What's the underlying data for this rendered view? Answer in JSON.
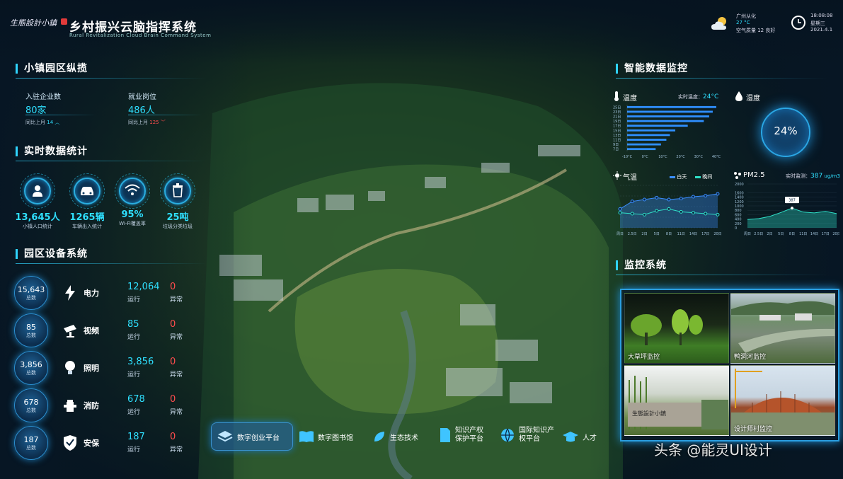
{
  "header": {
    "logo_text": "生態設計小鎮",
    "title": "乡村振兴云脑指挥系统",
    "subtitle": "Rural Revitalization Cloud Brain Command System",
    "weather": {
      "icon": "cloud-sun-icon",
      "city": "广州从化",
      "temp": "27 °C",
      "air": "空气质量 12 良好"
    },
    "time": {
      "icon": "clock-icon",
      "clock": "18:08:08",
      "weekday": "星期三",
      "date": "2021.4.1"
    }
  },
  "overview": {
    "title": "小镇园区纵揽",
    "items": [
      {
        "label": "入驻企业数",
        "value": "80家",
        "compare": "同比上月",
        "change": "14"
      },
      {
        "label": "就业岗位",
        "value": "486人",
        "compare": "同比上月",
        "change": "125"
      }
    ]
  },
  "realtime": {
    "title": "实时数据统计",
    "items": [
      {
        "icon": "person-icon",
        "value": "13,645人",
        "label": "小镇人口统计"
      },
      {
        "icon": "car-icon",
        "value": "1265辆",
        "label": "车辆出入统计"
      },
      {
        "icon": "wifi-icon",
        "value": "95%",
        "label": "Wi-Fi覆盖率"
      },
      {
        "icon": "trash-icon",
        "value": "25吨",
        "label": "垃圾分类垃圾"
      }
    ]
  },
  "devices": {
    "title": "园区设备系统",
    "run_label": "运行",
    "err_label": "异常",
    "total_label": "总数",
    "items": [
      {
        "icon": "lightning-icon",
        "total": "15,643",
        "name": "电力",
        "run": "12,064",
        "err": "0"
      },
      {
        "icon": "camera-icon",
        "total": "85",
        "name": "视频",
        "run": "85",
        "err": "0"
      },
      {
        "icon": "bulb-icon",
        "total": "3,856",
        "name": "照明",
        "run": "3,856",
        "err": "0"
      },
      {
        "icon": "hydrant-icon",
        "total": "678",
        "name": "消防",
        "run": "678",
        "err": "0"
      },
      {
        "icon": "shield-icon",
        "total": "187",
        "name": "安保",
        "run": "187",
        "err": "0"
      }
    ]
  },
  "bottom_nav": [
    {
      "icon": "layers-icon",
      "label": "数字创业平台"
    },
    {
      "icon": "book-icon",
      "label": "数字图书馆"
    },
    {
      "icon": "leaf-icon",
      "label": "生态技术"
    },
    {
      "icon": "document-icon",
      "label": "知识产权保护平台"
    },
    {
      "icon": "globe-icon",
      "label": "国际知识产权平台"
    },
    {
      "icon": "graduation-cap-icon",
      "label": "人才"
    }
  ],
  "monitor": {
    "title": "智能数据监控",
    "temperature": {
      "label": "温度",
      "realtime_label": "实时温度：",
      "realtime_value": "24°C"
    },
    "humidity": {
      "label": "湿度",
      "value": "24%"
    },
    "weather_chart": {
      "label": "气温",
      "legend": [
        "白天",
        "晚间"
      ]
    },
    "pm25": {
      "label": "PM2.5",
      "realtime_label": "实时监测：",
      "realtime_value": "387",
      "unit": "ug/m3",
      "marker": "387"
    }
  },
  "surveillance": {
    "title": "监控系统",
    "cameras": [
      {
        "label": "大草坪监控"
      },
      {
        "label": "鸭洞河监控"
      },
      {
        "label": ""
      },
      {
        "label": "设计师村监控"
      }
    ]
  },
  "watermark": "头条 @能灵UI设计",
  "chart_data": [
    {
      "type": "bar",
      "orientation": "horizontal",
      "title": "温度",
      "categories": [
        "25日",
        "23日",
        "21日",
        "19日",
        "17日",
        "15日",
        "13日",
        "11日",
        "9日",
        "7日"
      ],
      "series": [
        {
          "values": [
            40,
            38,
            36,
            33,
            24,
            17,
            14,
            12,
            9,
            6
          ]
        }
      ],
      "x_ticks": [
        "-10°C",
        "0°C",
        "10°C",
        "20°C",
        "30°C",
        "40°C"
      ],
      "xlim": [
        -10,
        40
      ]
    },
    {
      "type": "line",
      "title": "气温",
      "x": [
        "周日",
        "2.5日",
        "2日",
        "5日",
        "8日",
        "11日",
        "14日",
        "17日",
        "20日"
      ],
      "series": [
        {
          "name": "白天",
          "values": [
            20,
            28,
            30,
            32,
            30,
            31,
            33,
            34,
            36
          ]
        },
        {
          "name": "晚间",
          "values": [
            16,
            15,
            14,
            18,
            20,
            17,
            16,
            15,
            14
          ]
        }
      ],
      "ylim": [
        0,
        45
      ]
    },
    {
      "type": "area",
      "title": "PM2.5",
      "x": [
        "周日",
        "2.5日",
        "2日",
        "5日",
        "8日",
        "11日",
        "14日",
        "17日",
        "20日"
      ],
      "series": [
        {
          "values": [
            380,
            420,
            520,
            700,
            900,
            720,
            680,
            750,
            650
          ]
        }
      ],
      "y_ticks": [
        "0",
        "200",
        "400",
        "600",
        "800",
        "1000",
        "1200",
        "1400",
        "1600",
        "2000"
      ],
      "ylim": [
        0,
        2000
      ]
    }
  ]
}
